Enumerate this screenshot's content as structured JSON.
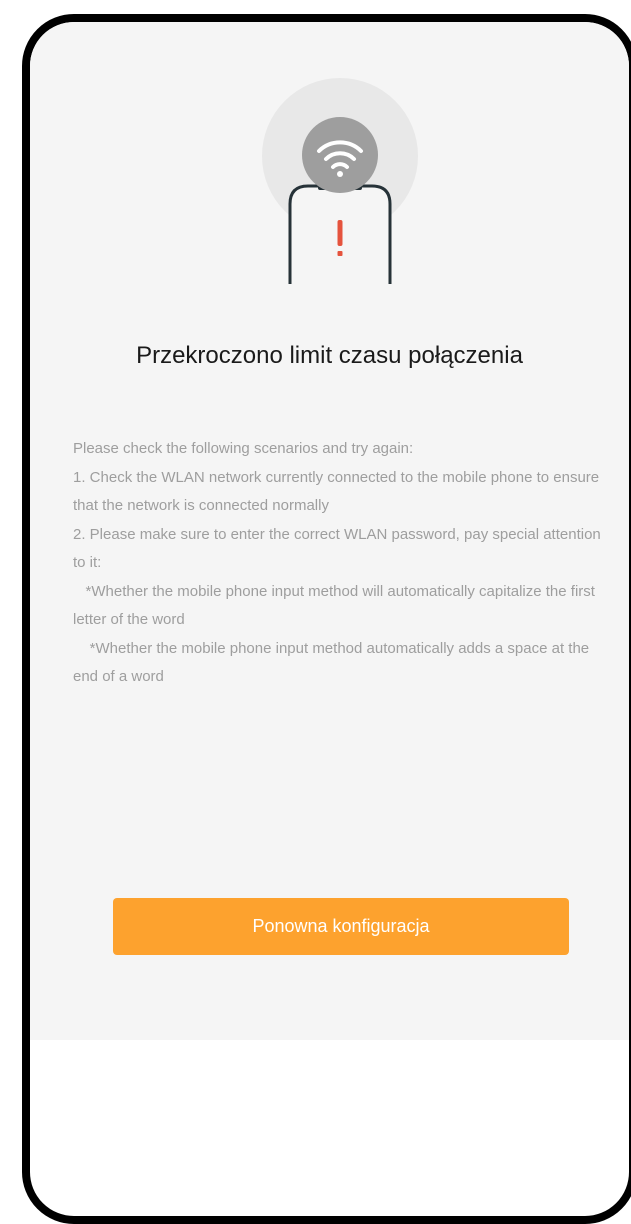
{
  "colors": {
    "accent": "#fda22e",
    "background": "#f5f5f5",
    "title": "#1a1a1a",
    "body_text": "#9e9e9e",
    "warning": "#e5533d"
  },
  "illustration": {
    "icons": [
      "wifi-icon",
      "phone-icon",
      "exclamation-icon"
    ]
  },
  "title": "Przekroczono limit czasu połączenia",
  "instructions": {
    "lines": [
      "Please check the following scenarios and try again:",
      "1. Check the WLAN network currently connected to the mobile phone to ensure that the network is connected normally",
      "2. Please make sure to enter the correct WLAN password, pay special attention to it:",
      "   *Whether the mobile phone input method will automatically capitalize the first letter of the word",
      "    *Whether the mobile phone input method automatically adds a space at the end of a word"
    ]
  },
  "retry_button_label": "Ponowna konfiguracja"
}
